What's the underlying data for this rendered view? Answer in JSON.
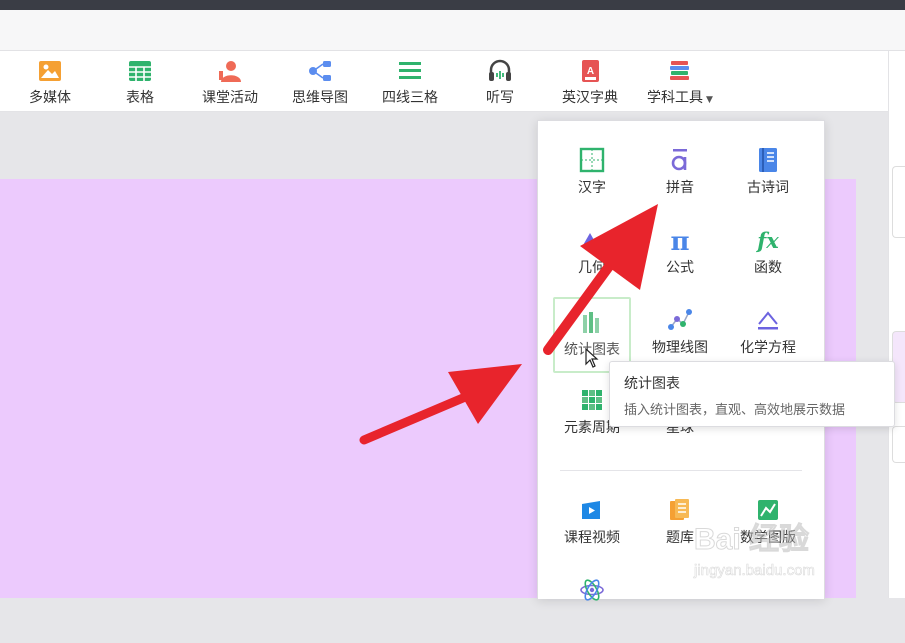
{
  "toolbar": {
    "items": [
      {
        "label": "多媒体",
        "icon": "image-icon",
        "color": "#f5a033"
      },
      {
        "label": "表格",
        "icon": "table-icon",
        "color": "#2fb36d"
      },
      {
        "label": "课堂活动",
        "icon": "person-icon",
        "color": "#ef6a56"
      },
      {
        "label": "思维导图",
        "icon": "mindmap-icon",
        "color": "#5b8def"
      },
      {
        "label": "四线三格",
        "icon": "lines-icon",
        "color": "#2fb36d"
      },
      {
        "label": "听写",
        "icon": "headphones-icon",
        "color": "#444444"
      },
      {
        "label": "英汉字典",
        "icon": "dictionary-icon",
        "color": "#e65454"
      },
      {
        "label": "学科工具",
        "icon": "books-icon",
        "color": "#e65454"
      }
    ]
  },
  "dropdown": {
    "items": [
      {
        "label": "汉字",
        "icon": "hanzi-grid-icon"
      },
      {
        "label": "拼音",
        "icon": "pinyin-icon"
      },
      {
        "label": "古诗词",
        "icon": "poem-book-icon"
      },
      {
        "label": "几何",
        "icon": "geometry-icon"
      },
      {
        "label": "公式",
        "icon": "pi-icon"
      },
      {
        "label": "函数",
        "icon": "fx-icon"
      },
      {
        "label": "统计图表",
        "icon": "bar-chart-icon"
      },
      {
        "label": "物理线图",
        "icon": "network-icon"
      },
      {
        "label": "化学方程",
        "icon": "equation-icon"
      },
      {
        "label": "元素周期",
        "icon": "periodic-table-icon"
      },
      {
        "label": "星球",
        "icon": "planet-icon"
      },
      {
        "label": "课程视频",
        "icon": "video-icon"
      },
      {
        "label": "题库",
        "icon": "question-bank-icon"
      },
      {
        "label": "数学图版",
        "icon": "math-board-icon"
      },
      {
        "label": "",
        "icon": "atom-icon"
      }
    ]
  },
  "tooltip": {
    "title": "统计图表",
    "description": "插入统计图表，直观、高效地展示数据"
  },
  "watermark": {
    "brand": "Bai 经验",
    "url": "jingyan.baidu.com"
  },
  "colors": {
    "canvas": "#eccafd",
    "accent_green": "#2fb36d",
    "arrow_red": "#e8242c"
  }
}
